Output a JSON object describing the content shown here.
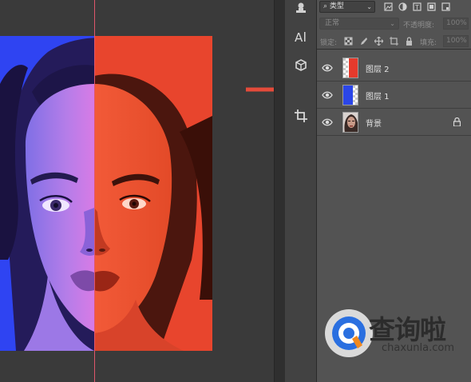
{
  "layers_panel": {
    "filter_kind": "类型",
    "blend_mode": "正常",
    "opacity_label": "不透明度:",
    "opacity_value": "100%",
    "lock_label": "锁定:",
    "fill_label": "填充:",
    "fill_value": "100%",
    "layers": [
      {
        "name": "图层 2",
        "thumb": "red-fill",
        "visible": true,
        "locked": false
      },
      {
        "name": "图层 1",
        "thumb": "blue-fill",
        "visible": true,
        "locked": false
      },
      {
        "name": "背景",
        "thumb": "portrait",
        "visible": true,
        "locked": true
      }
    ]
  },
  "toolbar_icons": [
    "stamp-icon",
    "character-icon",
    "3d-icon",
    "crop-icon"
  ],
  "watermark": {
    "title": "查询啦",
    "subtitle": "chaxunla.com"
  },
  "colors": {
    "layer_red": "#e63a2c",
    "layer_blue": "#2b46e8",
    "panel_bg": "#535353",
    "annotation_arrow": "#e44b3a"
  }
}
